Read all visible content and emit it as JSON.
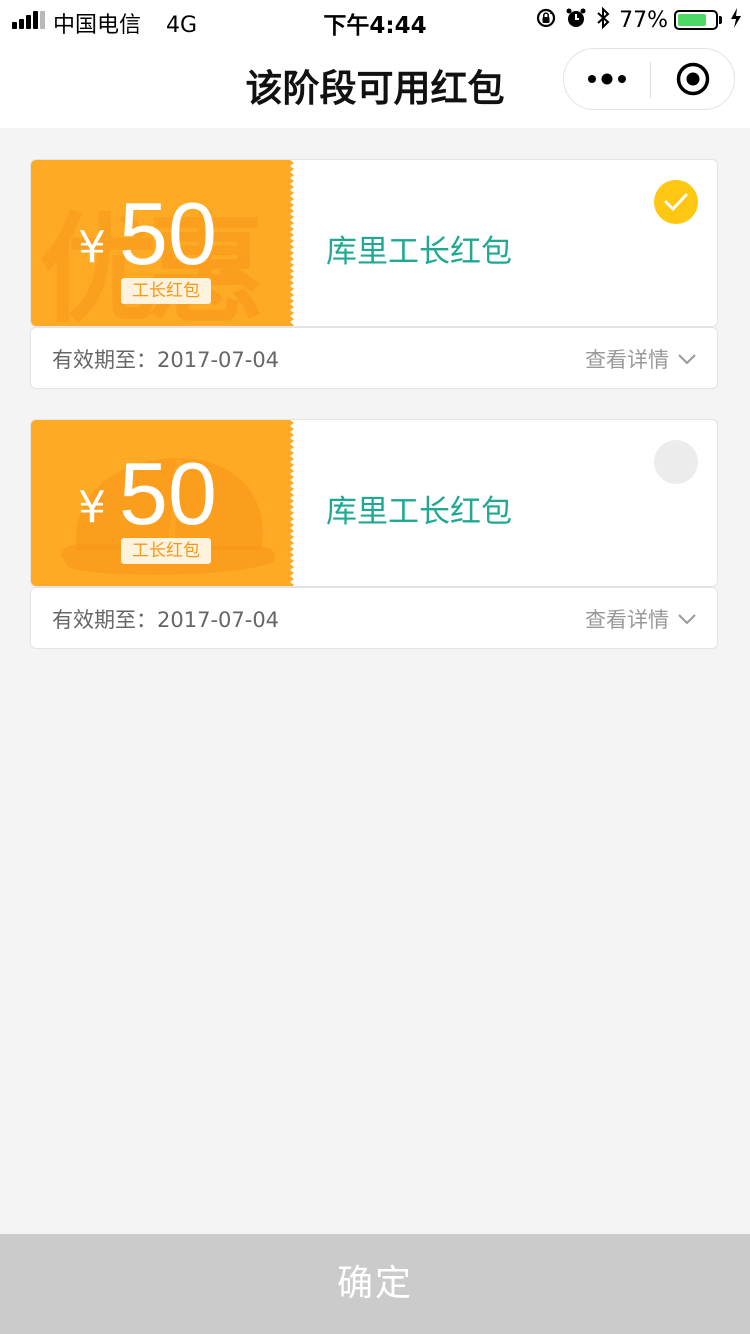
{
  "status_bar": {
    "carrier": "中国电信",
    "network": "4G",
    "time": "下午4:44",
    "battery_percent": "77%",
    "battery_level": 0.77,
    "icons": [
      "signal-icon",
      "rotation-lock-icon",
      "alarm-icon",
      "bluetooth-icon",
      "battery-icon",
      "charging-icon"
    ]
  },
  "nav": {
    "title": "该阶段可用红包",
    "icons": [
      "more-dots-icon",
      "close-target-icon"
    ]
  },
  "coupons": [
    {
      "currency": "¥",
      "amount": "50",
      "tag": "工长红包",
      "watermark": "优惠",
      "name": "库里工长红包",
      "selected": true,
      "validity": "有效期至：2017-07-04",
      "details_label": "查看详情"
    },
    {
      "currency": "¥",
      "amount": "50",
      "tag": "工长红包",
      "watermark": "",
      "name": "库里工长红包",
      "selected": false,
      "validity": "有效期至：2017-07-04",
      "details_label": "查看详情"
    }
  ],
  "colors": {
    "coupon_orange": "#ffaa25",
    "watermark_orange": "#f8961a",
    "name_teal": "#1fa993",
    "check_yellow": "#ffc612",
    "confirm_gray": "#cbcbcb"
  },
  "confirm_label": "确定"
}
